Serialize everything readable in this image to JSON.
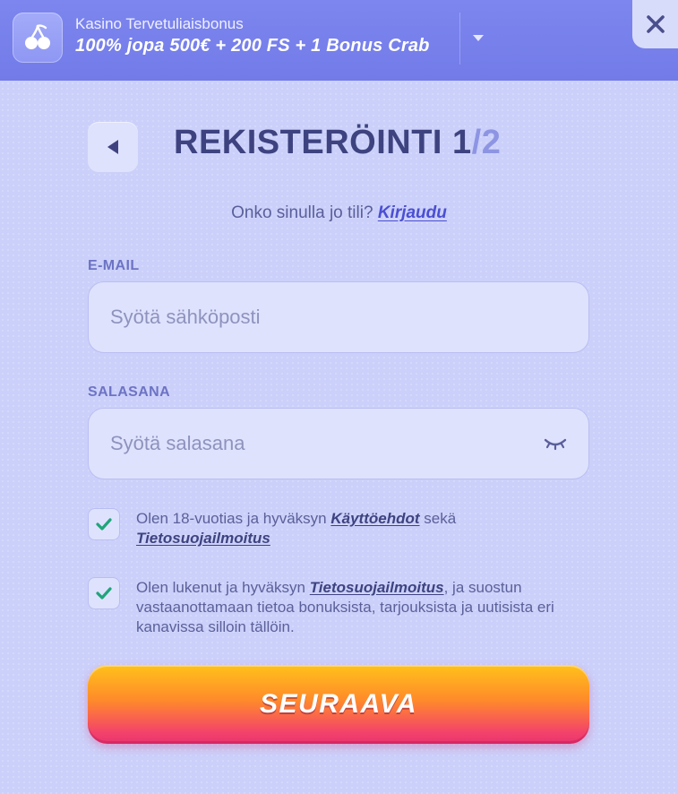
{
  "banner": {
    "subtitle": "Kasino Tervetuliaisbonus",
    "title": "100% jopa 500€ + 200 FS + 1 Bonus Crab",
    "icon": "cherry-icon",
    "close_icon": "close-icon",
    "expand_icon": "chevron-down-icon"
  },
  "header": {
    "title": "REKISTERÖINTI",
    "step_current": "1",
    "step_separator": "/",
    "step_total": "2",
    "back_icon": "back-arrow-icon"
  },
  "login_prompt": {
    "text": "Onko sinulla jo tili?",
    "link": "Kirjaudu"
  },
  "email": {
    "label": "E-MAIL",
    "placeholder": "Syötä sähköposti",
    "value": ""
  },
  "password": {
    "label": "SALASANA",
    "placeholder": "Syötä salasana",
    "value": "",
    "toggle_icon": "eye-closed-icon"
  },
  "consents": [
    {
      "checked": true,
      "text_before": "Olen 18-vuotias ja hyväksyn",
      "link1": "Käyttöehdot",
      "text_middle": "sekä",
      "link2": "Tietosuojailmoitus"
    },
    {
      "checked": true,
      "text_before": "Olen lukenut ja hyväksyn",
      "link1": "Tietosuojailmoitus",
      "text_after": ", ja suostun vastaanottamaan tietoa bonuksista, tarjouksista ja uutisista eri kanavissa silloin tällöin."
    }
  ],
  "submit": {
    "label": "SEURAAVA"
  },
  "colors": {
    "background": "#cbd0fa",
    "banner": "#7780eb",
    "title": "#3e4380",
    "checkmark": "#1fa57a",
    "button_top": "#ffc21a",
    "button_bottom": "#e8336f"
  }
}
